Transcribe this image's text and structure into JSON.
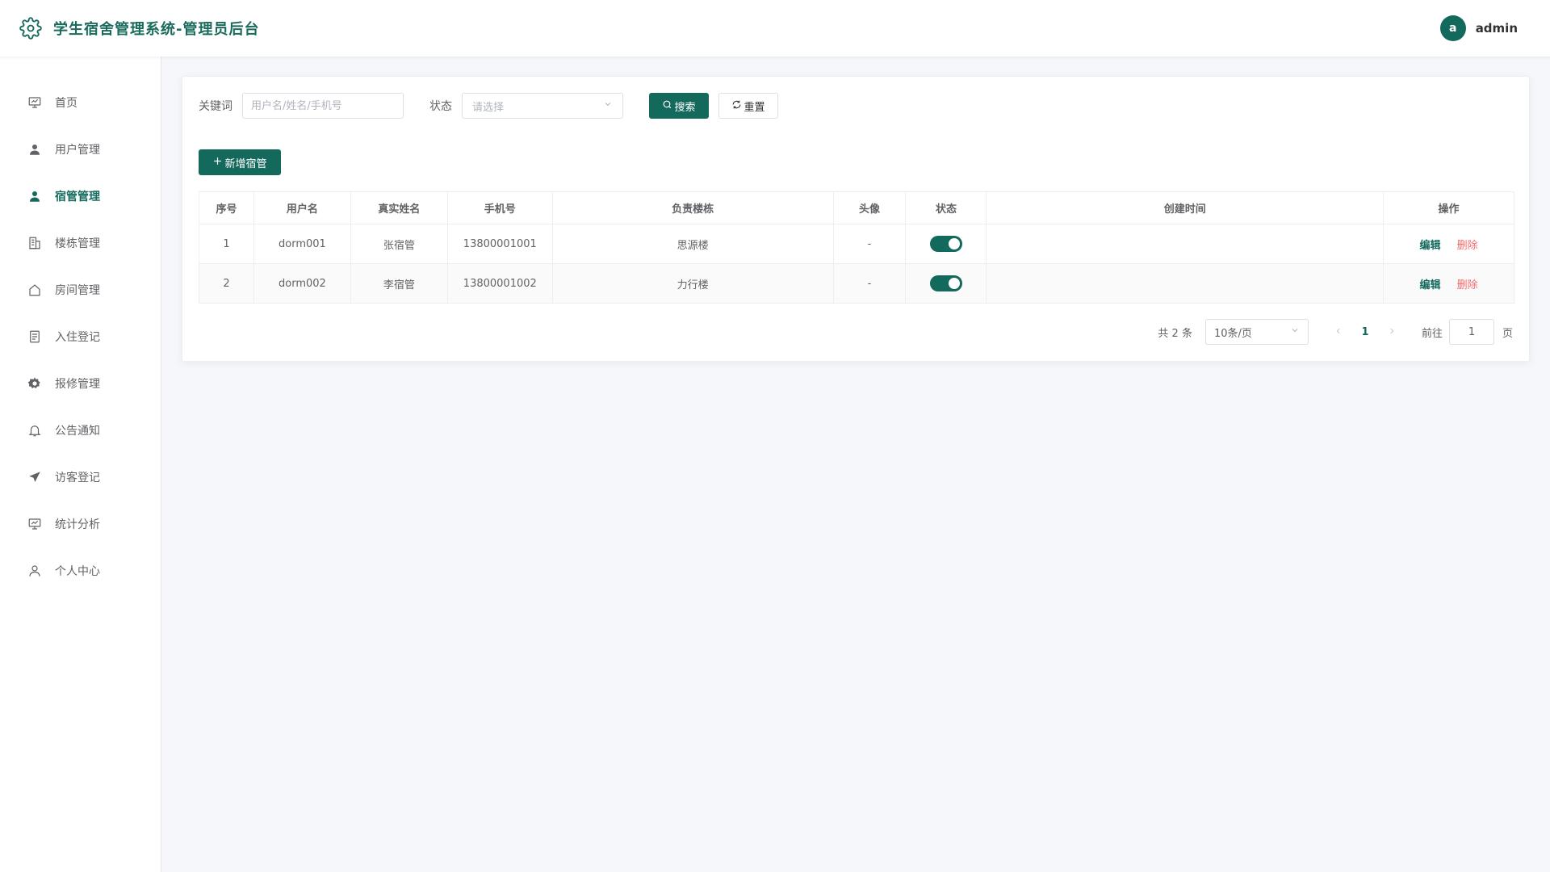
{
  "header": {
    "title": "学生宿舍管理系统-管理员后台",
    "logo_icon": "gear-icon",
    "avatar_letter": "a",
    "username": "admin"
  },
  "sidebar": {
    "items": [
      {
        "label": "首页",
        "icon": "dashboard-icon",
        "active": false
      },
      {
        "label": "用户管理",
        "icon": "user-icon",
        "active": false
      },
      {
        "label": "宿管管理",
        "icon": "user-icon",
        "active": true
      },
      {
        "label": "楼栋管理",
        "icon": "building-icon",
        "active": false
      },
      {
        "label": "房间管理",
        "icon": "house-icon",
        "active": false
      },
      {
        "label": "入住登记",
        "icon": "document-icon",
        "active": false
      },
      {
        "label": "报修管理",
        "icon": "settings-icon",
        "active": false
      },
      {
        "label": "公告通知",
        "icon": "bell-icon",
        "active": false
      },
      {
        "label": "访客登记",
        "icon": "send-icon",
        "active": false
      },
      {
        "label": "统计分析",
        "icon": "chart-board-icon",
        "active": false
      },
      {
        "label": "个人中心",
        "icon": "person-outline-icon",
        "active": false
      }
    ]
  },
  "search": {
    "keyword_label": "关键词",
    "keyword_placeholder": "用户名/姓名/手机号",
    "status_label": "状态",
    "status_placeholder": "请选择",
    "search_label": "搜索",
    "reset_label": "重置"
  },
  "toolbar": {
    "add_label": "新增宿管"
  },
  "table": {
    "columns": [
      "序号",
      "用户名",
      "真实姓名",
      "手机号",
      "负责楼栋",
      "头像",
      "状态",
      "创建时间",
      "操作"
    ],
    "rows": [
      {
        "index": "1",
        "username": "dorm001",
        "real_name": "张宿管",
        "phone": "13800001001",
        "building": "思源楼",
        "avatar": "-",
        "status_on": true,
        "created": "",
        "edit": "编辑",
        "delete": "删除"
      },
      {
        "index": "2",
        "username": "dorm002",
        "real_name": "李宿管",
        "phone": "13800001002",
        "building": "力行楼",
        "avatar": "-",
        "status_on": true,
        "created": "",
        "edit": "编辑",
        "delete": "删除"
      }
    ]
  },
  "pagination": {
    "total": "共 2 条",
    "page_size": "10条/页",
    "current_page": "1",
    "goto_label": "前往",
    "goto_value": "1",
    "page_suffix": "页"
  },
  "colors": {
    "accent": "#14695d",
    "danger": "#f56c6c"
  }
}
